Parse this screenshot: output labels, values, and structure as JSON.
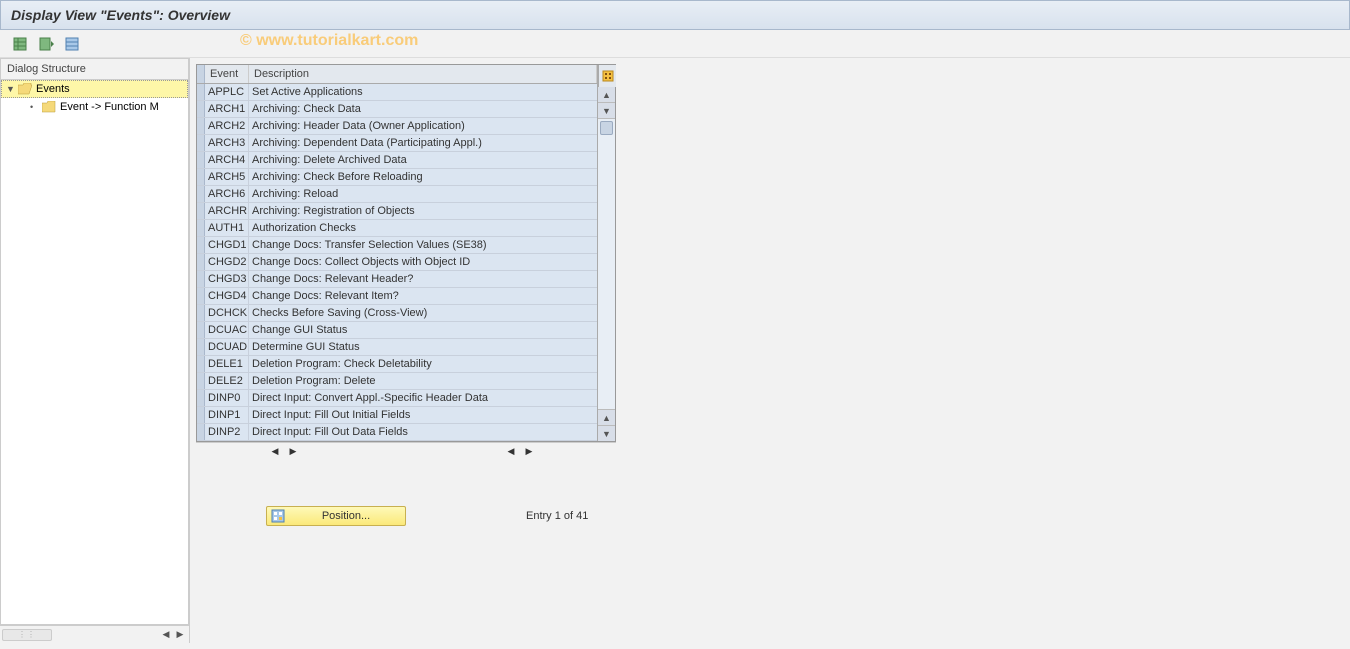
{
  "title": "Display View \"Events\": Overview",
  "watermark": "© www.tutorialkart.com",
  "sidebar": {
    "header": "Dialog Structure",
    "items": [
      {
        "label": "Events",
        "selected": true,
        "expanded": true
      },
      {
        "label": "Event -> Function M",
        "selected": false,
        "expanded": false
      }
    ]
  },
  "table": {
    "columns": {
      "event": "Event",
      "description": "Description"
    },
    "rows": [
      {
        "event": "APPLC",
        "description": "Set Active Applications"
      },
      {
        "event": "ARCH1",
        "description": "Archiving: Check Data"
      },
      {
        "event": "ARCH2",
        "description": "Archiving: Header Data (Owner Application)"
      },
      {
        "event": "ARCH3",
        "description": "Archiving: Dependent Data (Participating Appl.)"
      },
      {
        "event": "ARCH4",
        "description": "Archiving: Delete Archived Data"
      },
      {
        "event": "ARCH5",
        "description": "Archiving: Check Before Reloading"
      },
      {
        "event": "ARCH6",
        "description": "Archiving: Reload"
      },
      {
        "event": "ARCHR",
        "description": "Archiving: Registration of Objects"
      },
      {
        "event": "AUTH1",
        "description": "Authorization Checks"
      },
      {
        "event": "CHGD1",
        "description": "Change Docs: Transfer Selection Values (SE38)"
      },
      {
        "event": "CHGD2",
        "description": "Change Docs: Collect Objects with Object ID"
      },
      {
        "event": "CHGD3",
        "description": "Change Docs: Relevant Header?"
      },
      {
        "event": "CHGD4",
        "description": "Change Docs: Relevant Item?"
      },
      {
        "event": "DCHCK",
        "description": "Checks Before Saving (Cross-View)"
      },
      {
        "event": "DCUAC",
        "description": "Change GUI Status"
      },
      {
        "event": "DCUAD",
        "description": "Determine GUI Status"
      },
      {
        "event": "DELE1",
        "description": "Deletion Program: Check Deletability"
      },
      {
        "event": "DELE2",
        "description": "Deletion Program: Delete"
      },
      {
        "event": "DINP0",
        "description": "Direct Input: Convert Appl.-Specific Header Data"
      },
      {
        "event": "DINP1",
        "description": "Direct Input: Fill Out Initial Fields"
      },
      {
        "event": "DINP2",
        "description": "Direct Input: Fill Out Data Fields"
      }
    ]
  },
  "footer": {
    "position_label": "Position...",
    "entry_label": "Entry 1 of 41"
  }
}
